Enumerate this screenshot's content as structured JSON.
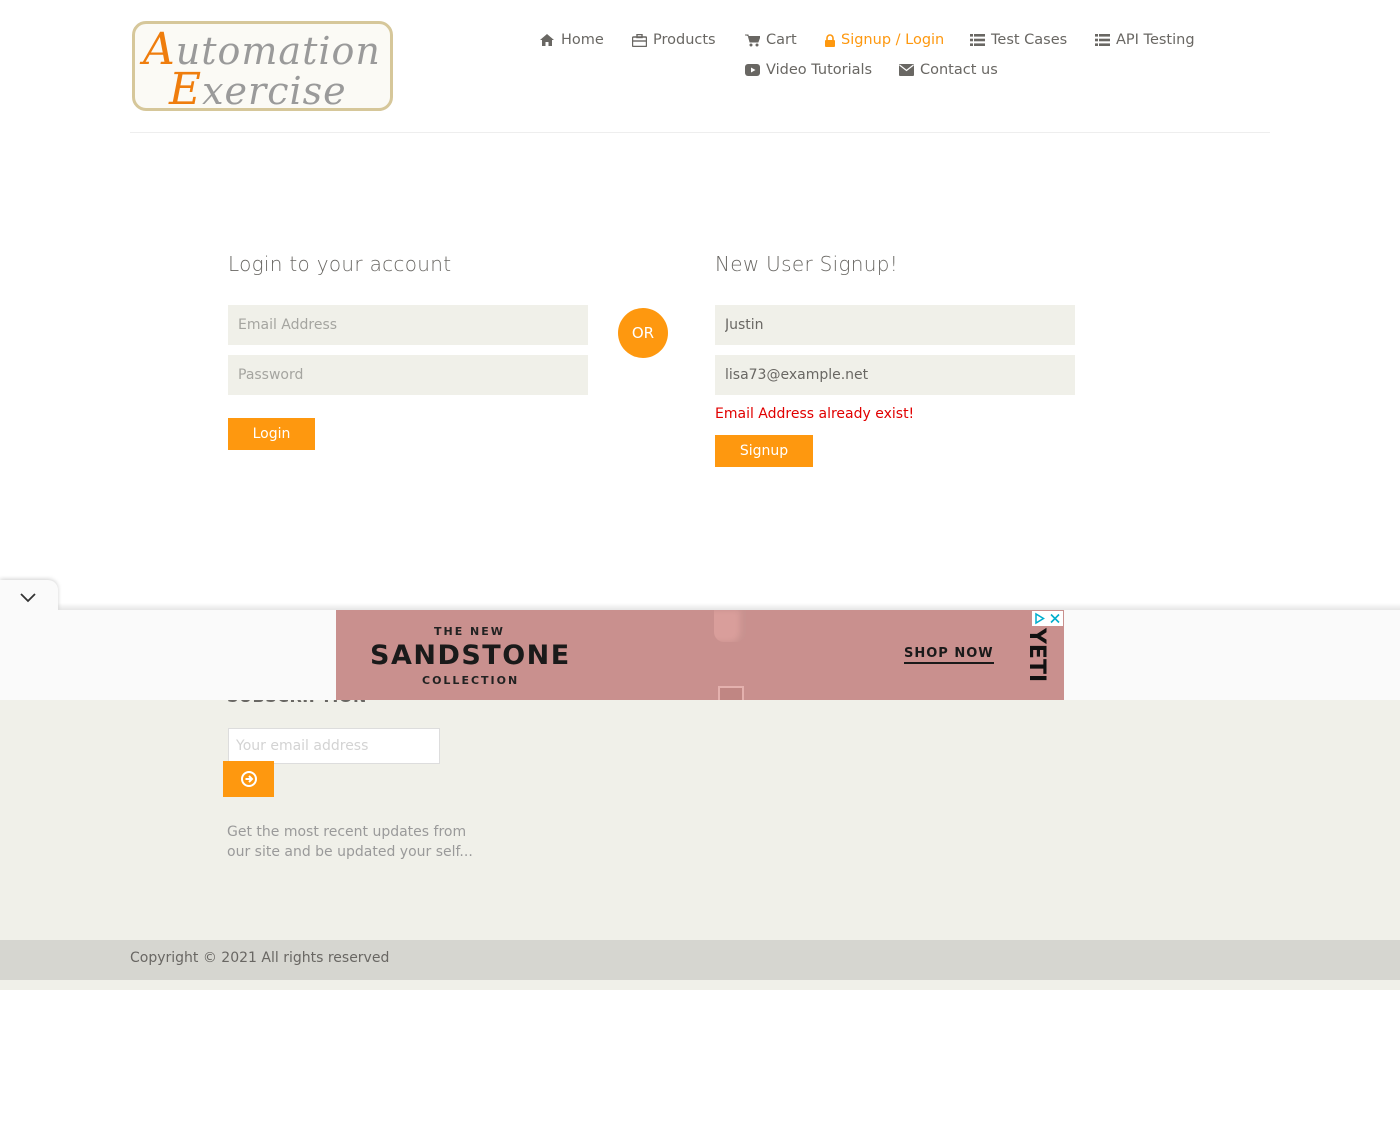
{
  "logo": {
    "line1_cap": "A",
    "line1_rest": "utomation",
    "line2_cap": "E",
    "line2_rest": "xercise"
  },
  "nav": {
    "home": "Home",
    "products": "Products",
    "cart": "Cart",
    "signup_login": "Signup / Login",
    "test_cases": "Test Cases",
    "api_testing": "API Testing",
    "video_tutorials": "Video Tutorials",
    "contact_us": "Contact us"
  },
  "login": {
    "title": "Login to your account",
    "email_placeholder": "Email Address",
    "password_placeholder": "Password",
    "button": "Login"
  },
  "or_label": "OR",
  "signup": {
    "title": "New User Signup!",
    "name_value": "Justin",
    "email_value": "lisa73@example.net",
    "error": "Email Address already exist!",
    "button": "Signup"
  },
  "subscription": {
    "title": "SUBSCRIPTION",
    "placeholder": "Your email address",
    "description": "Get the most recent updates from our site and be updated your self..."
  },
  "footer": {
    "copyright": "Copyright © 2021 All rights reserved"
  },
  "ad": {
    "the_new": "THE NEW",
    "headline": "SANDSTONE",
    "sub": "COLLECTION",
    "cta": "SHOP NOW",
    "brand": "YETI"
  },
  "colors": {
    "accent": "#fe980f",
    "error": "#e10000",
    "field_bg": "#f0f0e9",
    "ad_bg": "#c9908e"
  },
  "icons": {
    "home": "home-icon",
    "products": "briefcase-icon",
    "cart": "cart-icon",
    "signup_login": "lock-icon",
    "test_cases": "list-icon",
    "api_testing": "list-icon",
    "video_tutorials": "youtube-play-icon",
    "contact_us": "envelope-icon",
    "subscribe": "arrow-circle-right-icon",
    "ad_toggle": "chevron-down-icon",
    "ad_info": "adchoices-icon",
    "ad_close": "close-icon"
  }
}
